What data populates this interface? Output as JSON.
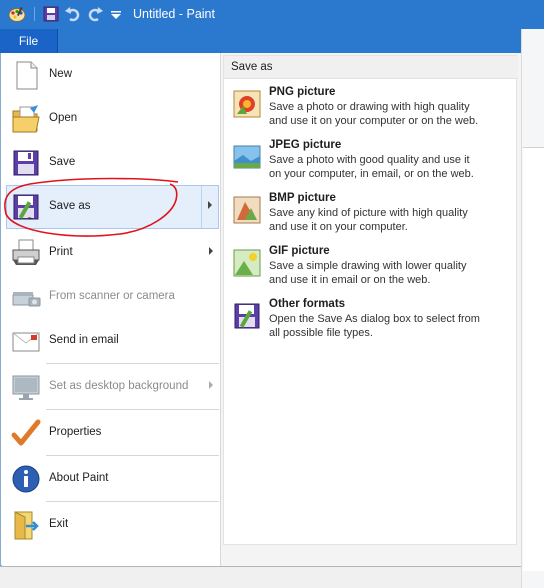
{
  "titlebar": {
    "title": "Untitled - Paint",
    "icons": [
      "paint-app-icon",
      "save-icon",
      "undo-icon",
      "redo-icon",
      "customize-dropdown-icon"
    ]
  },
  "file_tab": {
    "label": "File"
  },
  "menu": {
    "items": [
      {
        "label": "New",
        "icon": "new-document-icon",
        "enabled": true,
        "has_submenu": false
      },
      {
        "label": "Open",
        "icon": "open-folder-icon",
        "enabled": true,
        "has_submenu": false
      },
      {
        "label": "Save",
        "icon": "save-disk-icon",
        "enabled": true,
        "has_submenu": false
      },
      {
        "label": "Save as",
        "icon": "save-as-icon",
        "enabled": true,
        "has_submenu": true,
        "selected": true
      },
      {
        "label": "Print",
        "icon": "printer-icon",
        "enabled": true,
        "has_submenu": true
      },
      {
        "label": "From scanner or camera",
        "icon": "scanner-icon",
        "enabled": false,
        "has_submenu": false
      },
      {
        "label": "Send in email",
        "icon": "email-icon",
        "enabled": true,
        "has_submenu": false
      },
      {
        "label": "Set as desktop background",
        "icon": "desktop-icon",
        "enabled": false,
        "has_submenu": true
      },
      {
        "label": "Properties",
        "icon": "checkmark-icon",
        "enabled": true,
        "has_submenu": false
      },
      {
        "label": "About Paint",
        "icon": "info-icon",
        "enabled": true,
        "has_submenu": false
      },
      {
        "label": "Exit",
        "icon": "exit-icon",
        "enabled": true,
        "has_submenu": false
      }
    ]
  },
  "save_as_panel": {
    "header": "Save as",
    "options": [
      {
        "title": "PNG picture",
        "desc_line1": "Save a photo or drawing with high quality",
        "desc_line2": "and use it on your computer or on the web.",
        "icon": "png-file-icon"
      },
      {
        "title": "JPEG picture",
        "desc_line1": "Save a photo with good quality and use it",
        "desc_line2": "on your computer, in email, or on the web.",
        "icon": "jpeg-file-icon"
      },
      {
        "title": "BMP picture",
        "desc_line1": "Save any kind of picture with high quality",
        "desc_line2": "and use it on your computer.",
        "icon": "bmp-file-icon"
      },
      {
        "title": "GIF picture",
        "desc_line1": "Save a simple drawing with lower quality",
        "desc_line2": "and use it in email or on the web.",
        "icon": "gif-file-icon"
      },
      {
        "title": "Other formats",
        "desc_line1": "Open the Save As dialog box to select from",
        "desc_line2": "all possible file types.",
        "icon": "other-formats-icon"
      }
    ]
  },
  "colors": {
    "titlebar": "#2b79cf",
    "file_tab": "#1a64c7",
    "selection": "#e4effb",
    "annotation": "#e0121b"
  }
}
